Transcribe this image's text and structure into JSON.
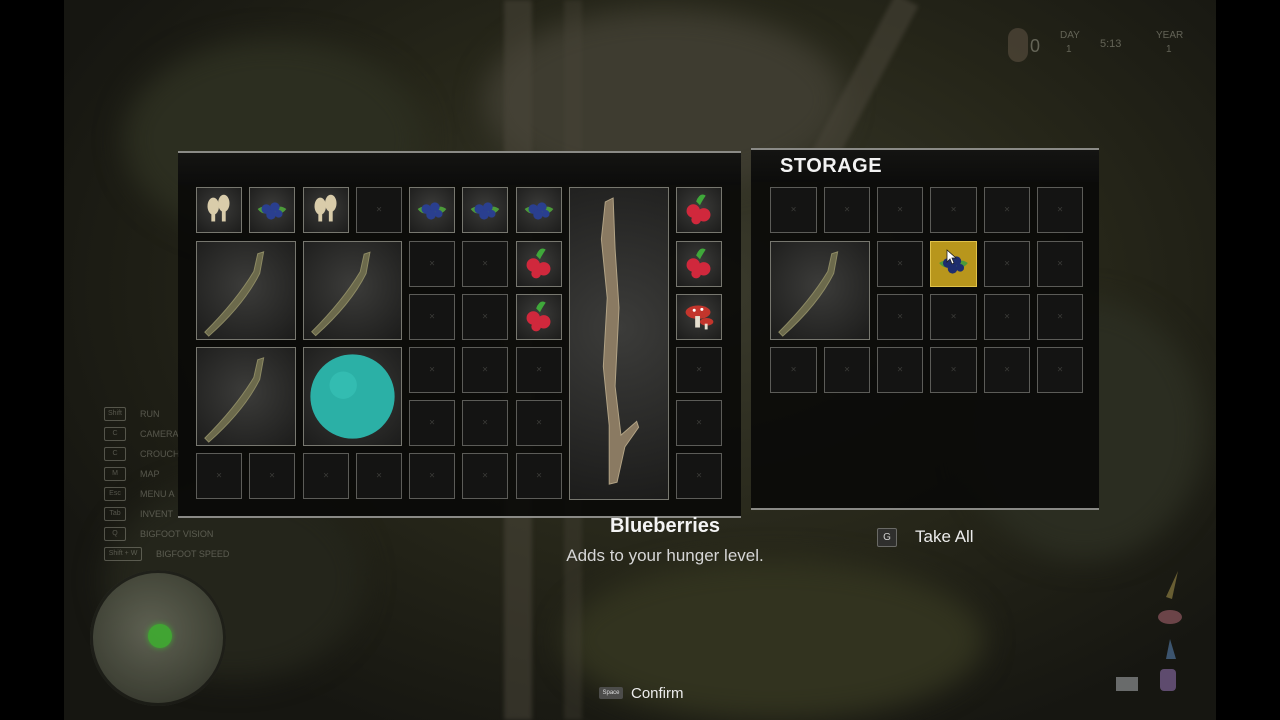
{
  "hud": {
    "clock_big": "0",
    "day_label": "DAY",
    "day_value": "1",
    "time_value": "5:13",
    "year_label": "YEAR",
    "year_value": "1"
  },
  "controls": [
    {
      "key": "Shift",
      "label": "RUN"
    },
    {
      "key": "C",
      "label": "CAMERA"
    },
    {
      "key": "C",
      "label": "CROUCH"
    },
    {
      "key": "M",
      "label": "MAP"
    },
    {
      "key": "Esc",
      "label": "MENU A"
    },
    {
      "key": "Tab",
      "label": "INVENT"
    },
    {
      "key": "Q",
      "label": "BIGFOOT VISION"
    },
    {
      "key": "Shift + W",
      "label": "BIGFOOT SPEED"
    }
  ],
  "inventory": {
    "slots_icons": [
      "mushroom-icon",
      "blueberries-icon",
      "mushroom-icon",
      "blueberries-icon",
      "blueberries-icon",
      "blueberries-icon",
      "raspberries-icon",
      "raspberries-icon",
      "raspberries-icon",
      "raspberries-icon",
      "toadstool-icon",
      "stick-icon",
      "stick-icon",
      "stick-icon",
      "slime-ball-icon",
      "large-stick-icon"
    ]
  },
  "storage": {
    "title": "STORAGE",
    "selected_item_icon": "blueberries-icon"
  },
  "item_info": {
    "name": "Blueberries",
    "description": "Adds to your hunger level."
  },
  "prompts": {
    "take_all_key": "G",
    "take_all_label": "Take All",
    "confirm_key": "Space",
    "confirm_label": "Confirm"
  },
  "colors": {
    "selected_slot": "#b8961c",
    "slot_border": "#5c5c58",
    "panel_bg": "#080807"
  }
}
